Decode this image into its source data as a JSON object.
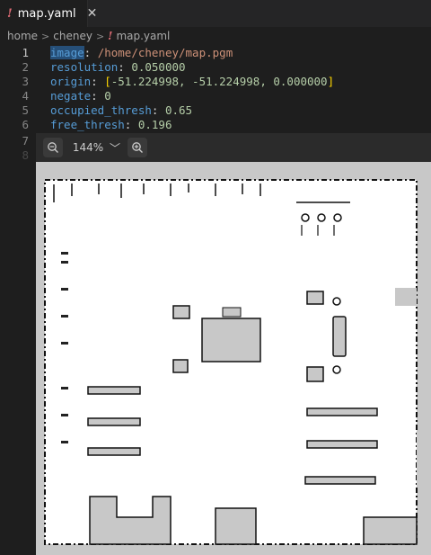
{
  "tab": {
    "label": "map.yaml",
    "close": "✕",
    "icon": "!"
  },
  "breadcrumb": {
    "items": [
      "home",
      "cheney"
    ],
    "file": "map.yaml",
    "icon": "!"
  },
  "editor": {
    "lines": [
      {
        "num": "1",
        "key": "image",
        "sep": ": ",
        "value": "/home/cheney/map.pgm"
      },
      {
        "num": "2",
        "key": "resolution",
        "sep": ": ",
        "value": "0.050000"
      },
      {
        "num": "3",
        "key": "origin",
        "sep": ": ",
        "value": "-51.224998, -51.224998, 0.000000"
      },
      {
        "num": "4",
        "key": "negate",
        "sep": ": ",
        "value": "0"
      },
      {
        "num": "5",
        "key": "occupied_thresh",
        "sep": ": ",
        "value": "0.65"
      },
      {
        "num": "6",
        "key": "free_thresh",
        "sep": ": ",
        "value": "0.196"
      },
      {
        "num": "7"
      },
      {
        "num": "8"
      }
    ]
  },
  "image_viewer": {
    "zoom": "144%",
    "zoom_in_icon": "zoom-in-icon",
    "zoom_out_icon": "zoom-out-icon"
  },
  "colors": {
    "background": "#1e1e1e",
    "key": "#569cd6",
    "string": "#ce9178",
    "number": "#b5cea8",
    "map_unknown": "#c8c8c8",
    "map_free": "#ffffff",
    "map_occupied": "#000000"
  }
}
